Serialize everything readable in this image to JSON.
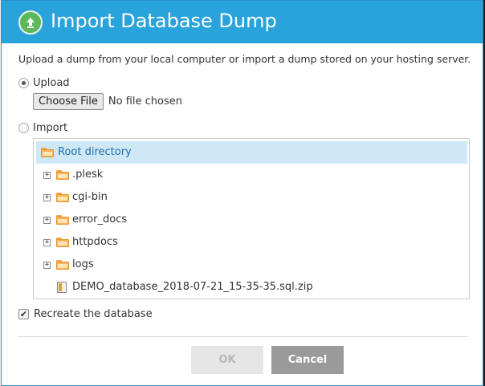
{
  "dialog": {
    "title": "Import Database Dump",
    "title_icon": "upload-icon",
    "accent_color": "#29a3dc",
    "description": "Upload a dump from your local computer or import a dump stored on your hosting server."
  },
  "upload_option": {
    "label": "Upload",
    "selected": true,
    "choose_file_label": "Choose File",
    "file_status": "No file chosen"
  },
  "import_option": {
    "label": "Import",
    "selected": false
  },
  "tree": {
    "root": {
      "label": "Root directory",
      "icon": "folder-icon",
      "selected": true
    },
    "items": [
      {
        "label": ".plesk",
        "type": "folder",
        "expandable": true
      },
      {
        "label": "cgi-bin",
        "type": "folder",
        "expandable": true
      },
      {
        "label": "error_docs",
        "type": "folder",
        "expandable": true
      },
      {
        "label": "httpdocs",
        "type": "folder",
        "expandable": true
      },
      {
        "label": "logs",
        "type": "folder",
        "expandable": true
      },
      {
        "label": "DEMO_database_2018-07-21_15-35-35.sql.zip",
        "type": "file",
        "expandable": false
      }
    ]
  },
  "recreate": {
    "label": "Recreate the database",
    "checked": true
  },
  "buttons": {
    "ok_label": "OK",
    "ok_enabled": false,
    "cancel_label": "Cancel"
  }
}
